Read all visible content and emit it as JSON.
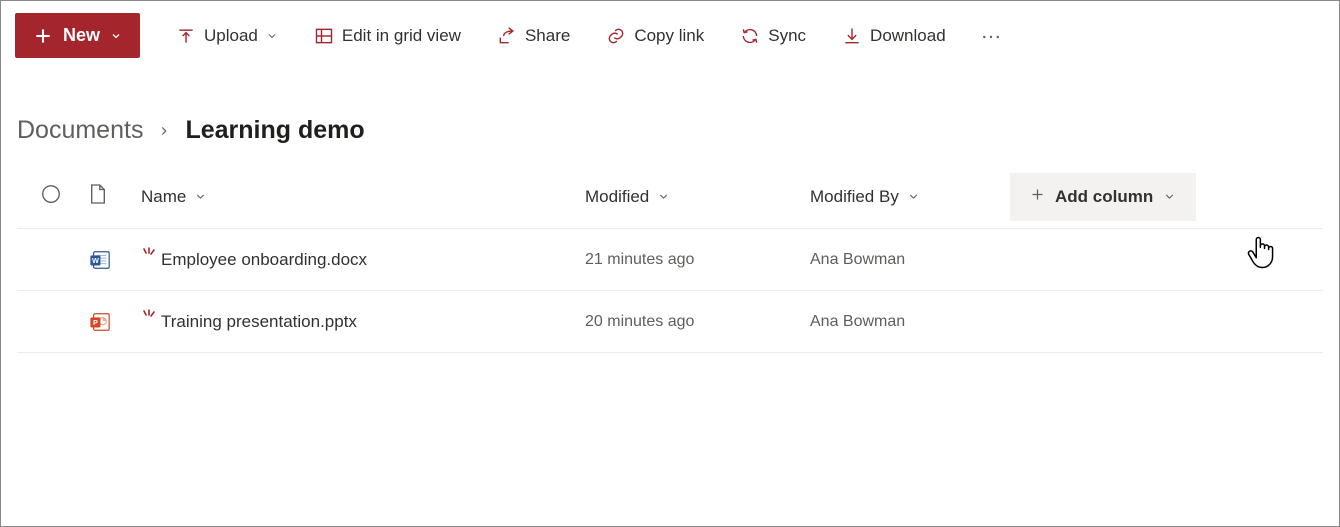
{
  "toolbar": {
    "new_label": "New",
    "upload_label": "Upload",
    "edit_grid_label": "Edit in grid view",
    "share_label": "Share",
    "copy_link_label": "Copy link",
    "sync_label": "Sync",
    "download_label": "Download"
  },
  "breadcrumb": {
    "root": "Documents",
    "current": "Learning demo"
  },
  "columns": {
    "name": "Name",
    "modified": "Modified",
    "modified_by": "Modified By",
    "add_column": "Add column"
  },
  "files": [
    {
      "type": "word",
      "name": "Employee onboarding.docx",
      "modified": "21 minutes ago",
      "modified_by": "Ana Bowman"
    },
    {
      "type": "powerpoint",
      "name": "Training presentation.pptx",
      "modified": "20 minutes ago",
      "modified_by": "Ana Bowman"
    }
  ],
  "colors": {
    "accent": "#a4262c",
    "icon_red": "#a4262c",
    "word_blue": "#2b579a",
    "ppt_orange": "#d24726"
  }
}
